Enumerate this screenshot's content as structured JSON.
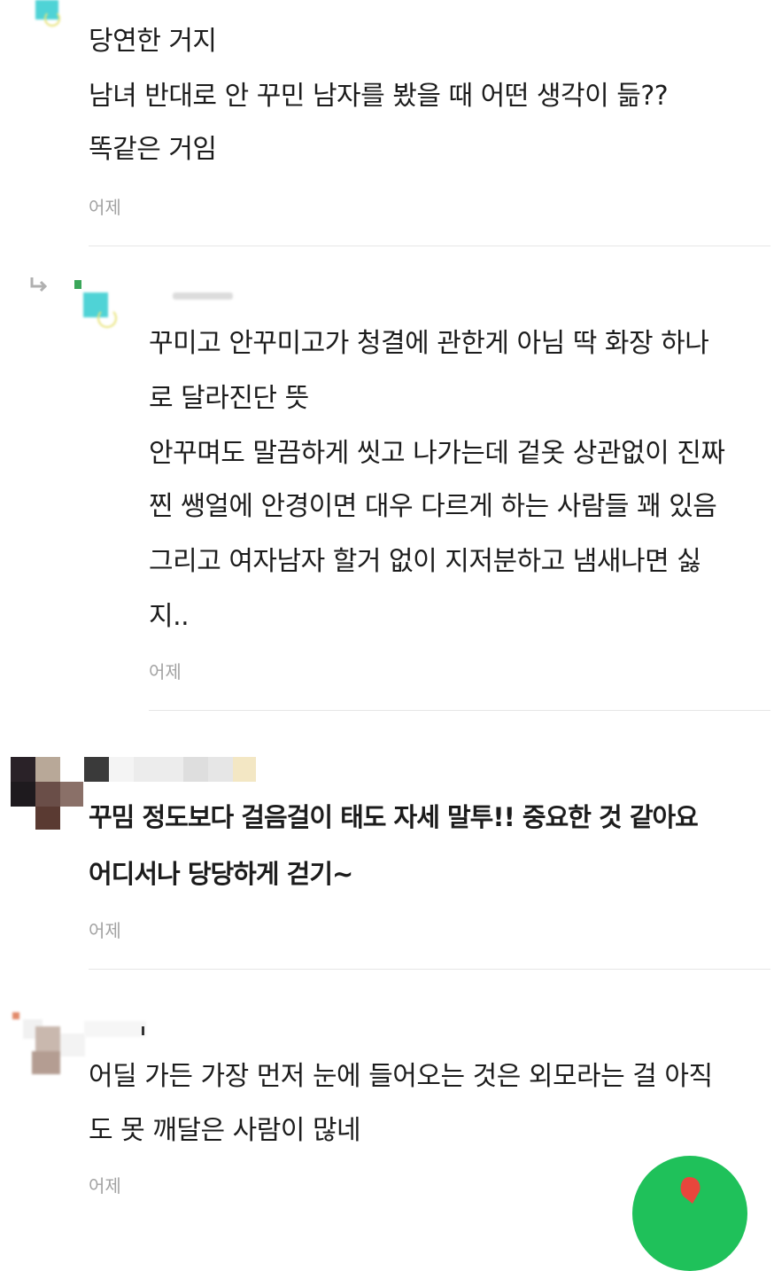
{
  "comments": [
    {
      "lines": [
        "당연한 거지",
        "남녀 반대로 안 꾸민 남자를 봤을 때 어떤 생각이 듦??",
        "똑같은 거임"
      ],
      "date": "어제"
    },
    {
      "is_reply": true,
      "lines": [
        "꾸미고 안꾸미고가 청결에 관한게 아님 딱 화장 하나",
        "로 달라진단 뜻",
        "안꾸며도 말끔하게 씻고 나가는데 겉옷 상관없이 진짜",
        "찐 쌩얼에 안경이면 대우 다르게 하는 사람들 꽤 있음",
        "그리고 여자남자 할거 없이 지저분하고 냄새나면 싫",
        "지.."
      ],
      "date": "어제"
    },
    {
      "lines": [
        "꾸밈 정도보다 걸음걸이 태도 자세 말투!! 중요한 것 같아요",
        "어디서나 당당하게 걷기~"
      ],
      "date": "어제"
    },
    {
      "lines": [
        "어딜 가든 가장 먼저 눈에 들어오는 것은 외모라는 걸 아직",
        "도 못 깨달은 사람이 많네"
      ],
      "date": "어제"
    }
  ],
  "icons": {
    "reply_arrow": "reply-arrow-icon",
    "floating_button": "write-comment-icon"
  },
  "colors": {
    "text": "#1c1c1c",
    "date": "#a3a3a3",
    "divider": "#e6e6e6",
    "fab": "#1fc15a",
    "fab_icon": "#e8463c"
  }
}
